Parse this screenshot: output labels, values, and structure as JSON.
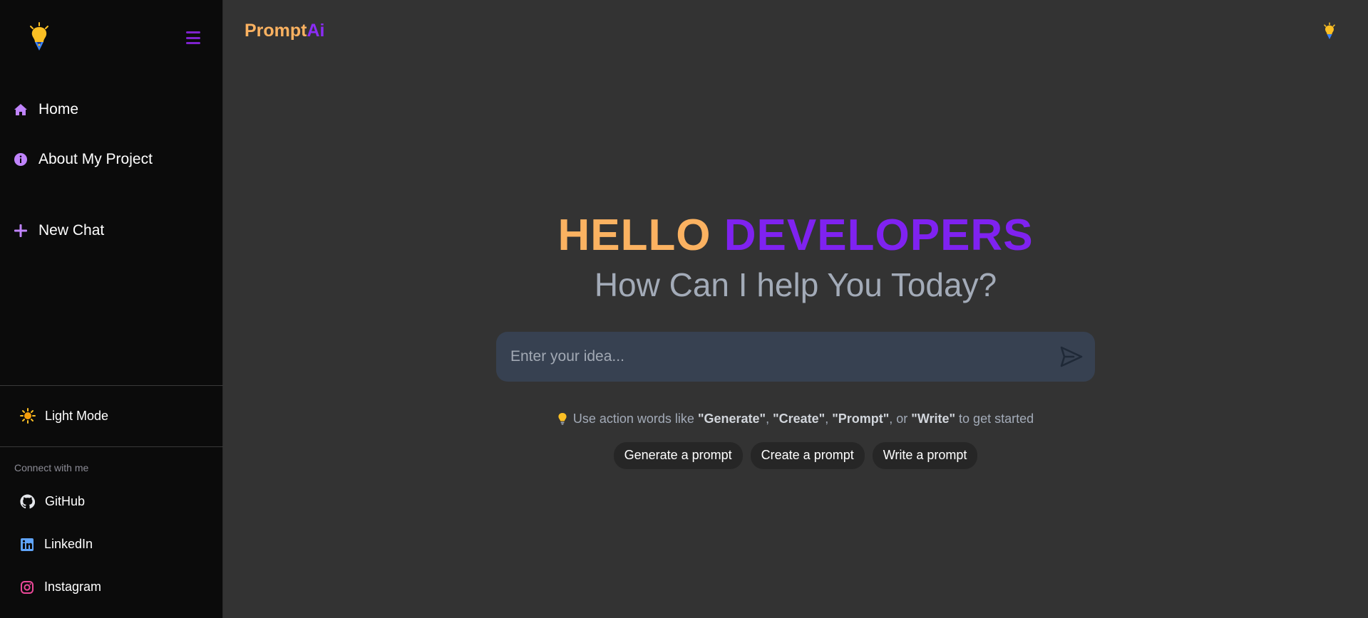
{
  "colors": {
    "brand_orange": "#fbb261",
    "brand_purple": "#7f22f0",
    "sidebar_bg": "#0b0b0b",
    "main_bg": "#333333",
    "input_bg": "#374151"
  },
  "brand": {
    "part1": "Prompt",
    "part2": "Ai",
    "logo_icon": "lightbulb-pen-icon"
  },
  "sidebar": {
    "menu_icon": "hamburger-icon",
    "nav": [
      {
        "label": "Home",
        "icon": "home-icon"
      },
      {
        "label": "About My Project",
        "icon": "info-icon"
      },
      {
        "label": "New Chat",
        "icon": "plus-icon"
      }
    ],
    "mode_toggle": {
      "label": "Light Mode",
      "icon": "sun-icon"
    },
    "connect_heading": "Connect with me",
    "socials": [
      {
        "label": "GitHub",
        "icon": "github-icon"
      },
      {
        "label": "LinkedIn",
        "icon": "linkedin-icon"
      },
      {
        "label": "Instagram",
        "icon": "instagram-icon"
      }
    ]
  },
  "hero": {
    "title_part1": "HELLO",
    "title_part2": "DEVELOPERS",
    "subtitle": "How Can I help You Today?"
  },
  "input": {
    "placeholder": "Enter your idea...",
    "value": "",
    "send_icon": "send-icon"
  },
  "hint": {
    "prefix": "Use action words like ",
    "w1": "\"Generate\"",
    "sep1": ", ",
    "w2": "\"Create\"",
    "sep2": ", ",
    "w3": "\"Prompt\"",
    "sep3": ", or ",
    "w4": "\"Write\"",
    "suffix": " to get started"
  },
  "chips": [
    "Generate a prompt",
    "Create a prompt",
    "Write a prompt"
  ]
}
